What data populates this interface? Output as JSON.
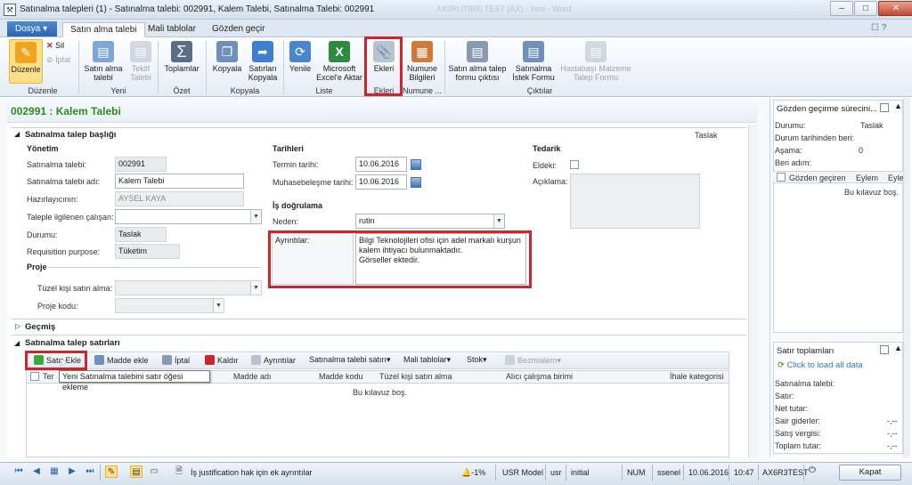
{
  "window": {
    "title": "Satınalma talepleri (1) - Satınalma talebi: 002991, Kalem Talebi, Satınalma Talebi: 002991",
    "faded_title": "AX0RUTB00 TEST (AX) - Yeni - Word",
    "minimize": "–",
    "maximize": "□",
    "close": "✕"
  },
  "menu": {
    "file": "Dosya",
    "tabs": [
      "Satın alma talebi",
      "Mali tablolar",
      "Gözden geçir"
    ]
  },
  "ribbon": {
    "buttons": {
      "edit": "Düzenle",
      "delete": "Sil",
      "cancel": "İptal",
      "purchase_request": "Satın alma talebi",
      "quote_request": "Teklif Talebi",
      "totals": "Toplamlar",
      "copy": "Kopyala",
      "copy_lines": "Satırları Kopyala",
      "refresh": "Yenile",
      "excel": "Microsoft Excel'e Aktar",
      "attachments": "Ekleri",
      "sample_info": "Numune Bilgileri",
      "print": "Satın alma talep formu çıktısı",
      "request_form": "Satınalma İstek Formu",
      "hospital_form": "Hastabaşı Malzeme Talep Formu"
    },
    "groups": {
      "edit": "Düzenle",
      "new": "Yeni",
      "summary": "Özet",
      "copy": "Kopyala",
      "list": "Liste",
      "attachments": "Ekleri",
      "sample": "Numune ...",
      "outputs": "Çıktılar"
    }
  },
  "page": {
    "title": "002991 : Kalem Talebi",
    "status_right": "Taslak"
  },
  "header_section": {
    "title": "Satınalma talep başlığı",
    "management": {
      "title": "Yönetim",
      "fields": [
        {
          "label": "Satınalma talebi:",
          "value": "002991"
        },
        {
          "label": "Satınalma talebi adı:",
          "value": "Kalem Talebi"
        },
        {
          "label": "Hazırlayıcının:",
          "value": "AYSEL KAYA"
        },
        {
          "label": "Taleple ilgilenen çalışan:",
          "value": ""
        },
        {
          "label": "Durumu:",
          "value": "Taslak"
        },
        {
          "label": "Requisition purpose:",
          "value": "Tüketim"
        }
      ]
    },
    "project": {
      "title": "Proje",
      "fields": [
        {
          "label": "Tüzel kişi satın alma:",
          "value": ""
        },
        {
          "label": "Proje kodu:",
          "value": ""
        }
      ]
    },
    "dates": {
      "title": "Tarihleri",
      "fields": [
        {
          "label": "Termin tarihi:",
          "value": "10.06.2016"
        },
        {
          "label": "Muhasebeleşme tarihi:",
          "value": "10.06.2016"
        }
      ]
    },
    "justification": {
      "title": "İş doğrulama",
      "reason_label": "Neden:",
      "reason_value": "rutin",
      "details_label": "Ayrıntılar:",
      "details_value": "Bilgi Teknolojileri ofisi için adel markalı kurşun kalem ihtiyacı bulunmaktadır.\nGörseller ektedir."
    },
    "supply": {
      "title": "Tedarik",
      "fields": [
        {
          "label": "Eldeki:",
          "value": ""
        },
        {
          "label": "Açıklama:",
          "value": ""
        }
      ]
    }
  },
  "history": {
    "title": "Geçmiş"
  },
  "lines_section": {
    "title": "Satınalma talep satırları",
    "toolbar": [
      "Satır Ekle",
      "Madde ekle",
      "İptal",
      "Kaldır",
      "Ayrıntılar",
      "Satınalma talebi satırı▾",
      "Mali tablolar▾",
      "Stok▾",
      "Bezmialem▾"
    ],
    "columns": [
      "Ter",
      "Madde adı",
      "Madde kodu",
      "Tüzel kişi satın alma",
      "Alıcı çalışma birimi",
      "İhale kategorisi"
    ],
    "empty_text": "Bu kılavuz boş.",
    "tooltip": "Yeni Satınalma talebini satır öğesi ekleme"
  },
  "review_panel": {
    "title": "Gözden geçirme sürecini...",
    "rows": [
      {
        "label": "Durumu:",
        "value": "Taslak"
      },
      {
        "label": "Durum tarihinden beri:",
        "value": ""
      },
      {
        "label": "Aşama:",
        "value": "0"
      },
      {
        "label": "Beri adım:",
        "value": ""
      }
    ],
    "columns": [
      "Gözden geçiren",
      "Eylem",
      "Eyle"
    ],
    "empty_text": "Bu kılavuz boş."
  },
  "totals_panel": {
    "title": "Satır toplamları",
    "load_link": "Click to load all data",
    "rows": [
      {
        "label": "Satınalma talebi:",
        "value": ""
      },
      {
        "label": "Satır:",
        "value": ""
      },
      {
        "label": "Net tutar:",
        "value": ""
      },
      {
        "label": "Sair giderler:",
        "value": "-,--"
      },
      {
        "label": "Satış vergisi:",
        "value": "-,--"
      },
      {
        "label": "Toplam tutar:",
        "value": "-,--"
      }
    ]
  },
  "statusbar": {
    "help_text": "İş justification hak için ek ayrıntılar",
    "percent": "-1%",
    "model": "USR Model",
    "layer": "usr",
    "initial": "initial",
    "num": "NUM",
    "user": "ssenel",
    "date": "10.06.2016",
    "time": "10:47",
    "server": "AX6R3TEST",
    "close_button": "Kapat"
  },
  "colors": {
    "highlight_red": "#d2232a",
    "title_green": "#2e8b1e",
    "accent_blue": "#2a67b0"
  }
}
